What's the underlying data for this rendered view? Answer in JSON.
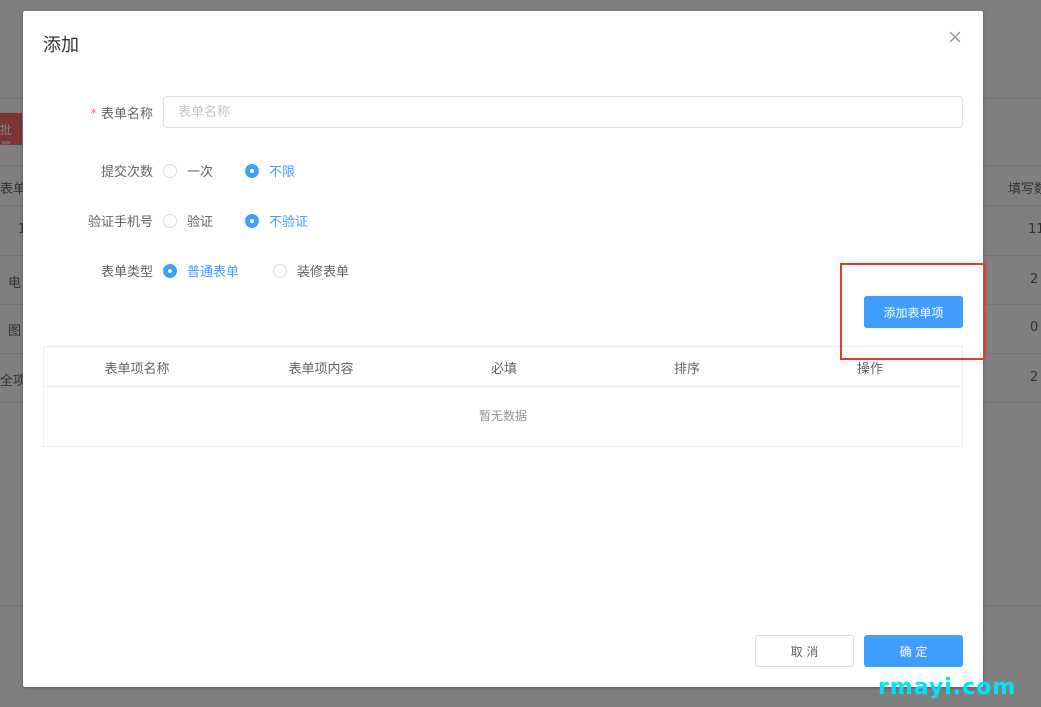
{
  "background": {
    "red_button_text": "批量删",
    "col_header_left": "表单",
    "col_header_right": "填写数",
    "rows": [
      {
        "left": "1",
        "right": "11"
      },
      {
        "left": "电",
        "right": "2"
      },
      {
        "left": "图",
        "right": "0"
      },
      {
        "left": "全项",
        "right": "2"
      }
    ]
  },
  "dialog": {
    "title": "添加",
    "close_icon": "close-icon",
    "form": {
      "name": {
        "required_mark": "*",
        "label": "表单名称",
        "placeholder": "表单名称",
        "value": ""
      },
      "submit_count": {
        "label": "提交次数",
        "options": [
          "一次",
          "不限"
        ],
        "selected": "不限"
      },
      "verify_phone": {
        "label": "验证手机号",
        "options": [
          "验证",
          "不验证"
        ],
        "selected": "不验证"
      },
      "form_type": {
        "label": "表单类型",
        "options": [
          "普通表单",
          "装修表单"
        ],
        "selected": "普通表单"
      }
    },
    "add_item_button": "添加表单项",
    "table": {
      "columns": [
        "表单项名称",
        "表单项内容",
        "必填",
        "排序",
        "操作"
      ],
      "empty_text": "暂无数据"
    },
    "footer": {
      "cancel": "取 消",
      "confirm": "确 定"
    }
  },
  "colors": {
    "primary": "#409eff",
    "highlight": "#e53935",
    "required": "#f56c6c"
  },
  "watermark": "rmayi.com"
}
